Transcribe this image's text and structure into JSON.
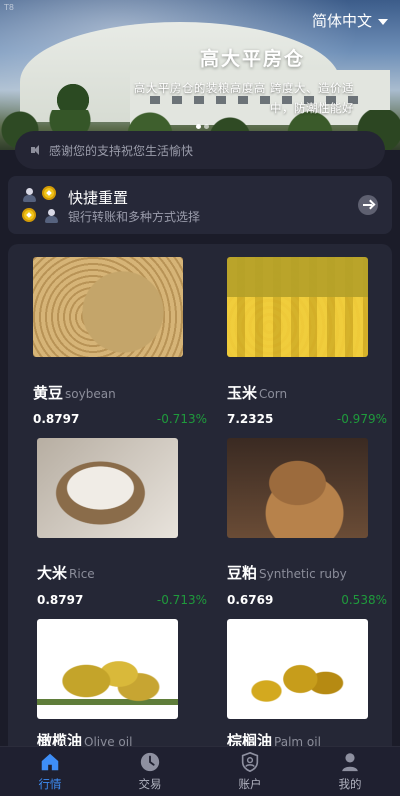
{
  "banner": {
    "corner_mark": "T8",
    "title": "高大平房仓",
    "subtitle": "高大平房仓的装粮高度高 跨度大、造价适中，防潮性能好",
    "language": "简体中文"
  },
  "notice": {
    "text": "感谢您的支持祝您生活愉快"
  },
  "quick": {
    "title": "快捷重置",
    "subtitle": "银行转账和多种方式选择"
  },
  "products": [
    {
      "name_cn": "黄豆",
      "name_en": "soybean",
      "price": "0.8797",
      "change": "-0.713%"
    },
    {
      "name_cn": "玉米",
      "name_en": "Corn",
      "price": "7.2325",
      "change": "-0.979%"
    },
    {
      "name_cn": "大米",
      "name_en": "Rice",
      "price": "0.8797",
      "change": "-0.713%"
    },
    {
      "name_cn": "豆粕",
      "name_en": "Synthetic ruby",
      "price": "0.6769",
      "change": "0.538%"
    },
    {
      "name_cn": "橄榄油",
      "name_en": "Olive oil",
      "price": "",
      "change": ""
    },
    {
      "name_cn": "棕榈油",
      "name_en": "Palm oil",
      "price": "",
      "change": ""
    }
  ],
  "tabs": [
    {
      "label": "行情",
      "icon": "home-icon",
      "active": true
    },
    {
      "label": "交易",
      "icon": "clock-icon",
      "active": false
    },
    {
      "label": "账户",
      "icon": "shield-user-icon",
      "active": false
    },
    {
      "label": "我的",
      "icon": "person-icon",
      "active": false
    }
  ],
  "colors": {
    "background": "#1b1c29",
    "card": "#252736",
    "accent": "#3e8ef7",
    "change_green": "#1f9a3c",
    "muted_text": "#9a9cab"
  }
}
